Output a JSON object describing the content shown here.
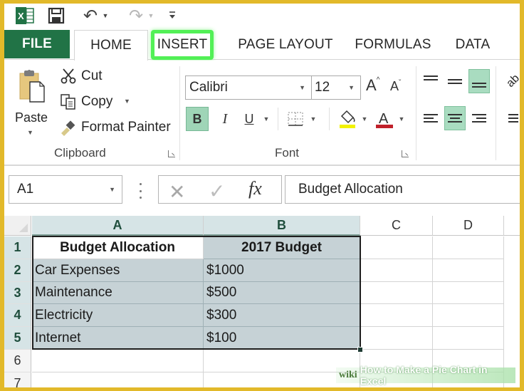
{
  "quick_access": {
    "app_icon": "excel-logo-icon",
    "save_icon": "save-icon",
    "undo_icon": "undo-icon",
    "redo_icon": "redo-icon",
    "customize_icon": "customize-toolbar-icon"
  },
  "tabs": [
    {
      "label": "FILE"
    },
    {
      "label": "HOME",
      "active": true
    },
    {
      "label": "INSERT",
      "highlighted": true
    },
    {
      "label": "PAGE LAYOUT"
    },
    {
      "label": "FORMULAS"
    },
    {
      "label": "DATA"
    }
  ],
  "ribbon": {
    "clipboard": {
      "paste_label": "Paste",
      "cut_label": "Cut",
      "copy_label": "Copy",
      "format_painter_label": "Format Painter",
      "group_label": "Clipboard"
    },
    "font": {
      "font_name": "Calibri",
      "font_size": "12",
      "bold_label": "B",
      "italic_label": "I",
      "underline_label": "U",
      "grow_label": "A",
      "shrink_label": "A",
      "font_color_label": "A",
      "group_label": "Font",
      "fill_color": "#f2f200",
      "font_color": "#c0202a",
      "bold_active": true
    },
    "alignment": {
      "bottom_align_active": true,
      "center_align_active": true
    }
  },
  "formula_bar": {
    "name_box": "A1",
    "fx_label": "fx",
    "content": "Budget Allocation"
  },
  "sheet": {
    "columns": [
      "A",
      "B",
      "C",
      "D"
    ],
    "rows": [
      "1",
      "2",
      "3",
      "4",
      "5",
      "6",
      "7"
    ],
    "cells": [
      [
        "Budget Allocation",
        "2017 Budget"
      ],
      [
        "Car Expenses",
        "$1000"
      ],
      [
        "Maintenance",
        "$500"
      ],
      [
        "Electricity",
        "$300"
      ],
      [
        "Internet",
        "$100"
      ]
    ],
    "selected_range": "A1:B5"
  },
  "watermark": {
    "brand": "wiki",
    "title": "How to Make a Pie Chart in Excel"
  },
  "colors": {
    "file_tab": "#217346",
    "insert_highlight": "#52f056",
    "frame_border": "#e2b92a",
    "selection_fill": "#c6d2d6"
  }
}
